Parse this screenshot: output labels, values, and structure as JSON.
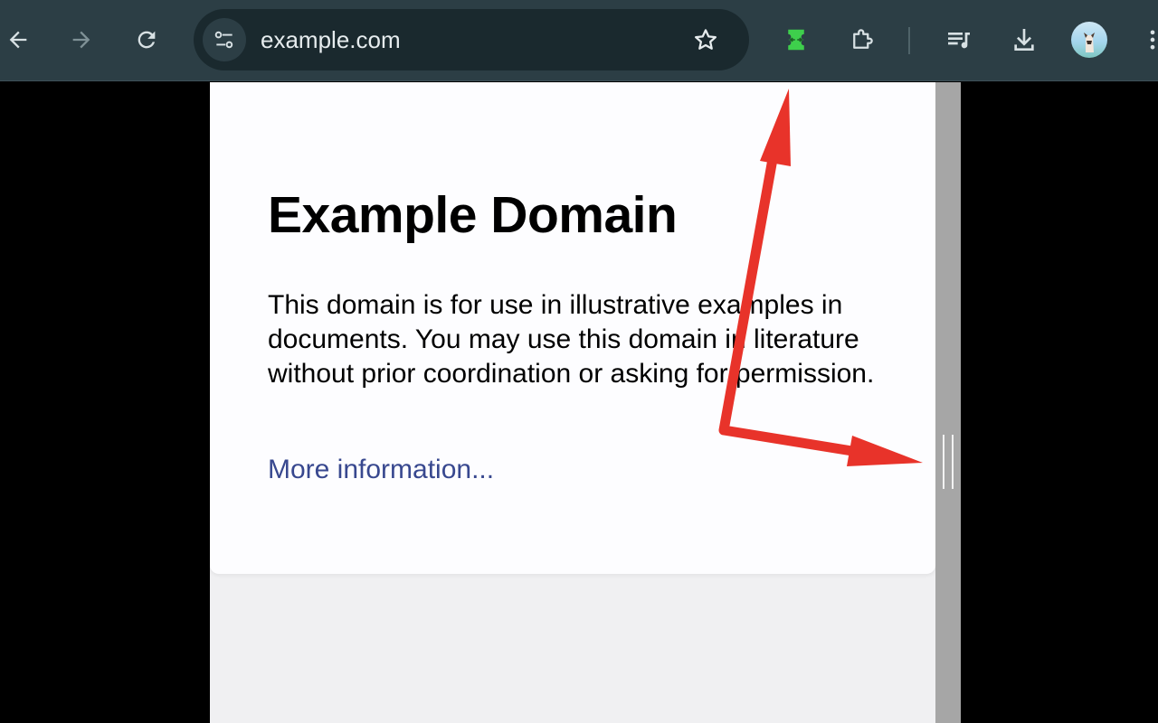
{
  "browser": {
    "url": "example.com",
    "buttons": {
      "back": "back-arrow-icon",
      "forward": "forward-arrow-icon",
      "reload": "reload-icon",
      "site_info": "tune-icon",
      "bookmark": "star-icon",
      "extension": "green-extension-icon",
      "extensions_menu": "puzzle-icon",
      "media": "playlist-icon",
      "downloads": "download-icon",
      "profile": "avatar",
      "menu": "kebab-menu-icon"
    },
    "colors": {
      "toolbar": "#2c3e45",
      "omnibox": "#1a292e",
      "extension_green": "#3ecf4c"
    }
  },
  "page": {
    "heading": "Example Domain",
    "paragraph": "This domain is for use in illustrative examples in documents. You may use this domain in literature without prior coordination or asking for permission.",
    "link_text": "More information...",
    "colors": {
      "card": "#fdfdff",
      "background": "#f0f0f2",
      "link": "#38488f"
    }
  },
  "annotation": {
    "color": "#e8332a",
    "description": "red arrows pointing to the extension icon and the scrollbar handle"
  }
}
